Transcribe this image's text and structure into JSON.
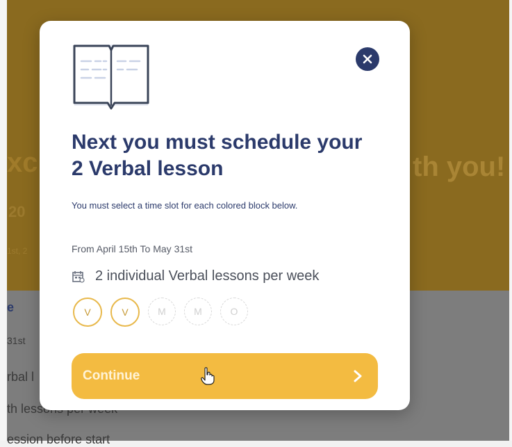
{
  "background": {
    "heading_left": "xc",
    "heading_right": "th you!",
    "subheading_left": "20",
    "date_left": "1st, 2",
    "section_initial": "e",
    "section_date": "31st",
    "line_1": "rbal l",
    "line_2": "th lessons per week",
    "line_3": "ession before start"
  },
  "modal": {
    "title": "Next you must schedule your 2 Verbal lesson",
    "subtitle": "You must select a time slot for each colored block below.",
    "date_range": "From April 15th To May 31st",
    "lessons_text": "2 individual Verbal lessons per week",
    "chips": [
      {
        "label": "V",
        "state": "active"
      },
      {
        "label": "V",
        "state": "active"
      },
      {
        "label": "M",
        "state": "inactive"
      },
      {
        "label": "M",
        "state": "inactive"
      },
      {
        "label": "O",
        "state": "inactive"
      }
    ],
    "continue_label": "Continue"
  },
  "icons": {
    "book": "book-icon",
    "close": "close-icon",
    "calendar": "calendar-icon",
    "chevron": "chevron-right-icon",
    "cursor": "hand-cursor-icon"
  },
  "colors": {
    "gold_bg": "#8a6a1f",
    "navy": "#2b3a6b",
    "accent": "#f3bb41"
  }
}
